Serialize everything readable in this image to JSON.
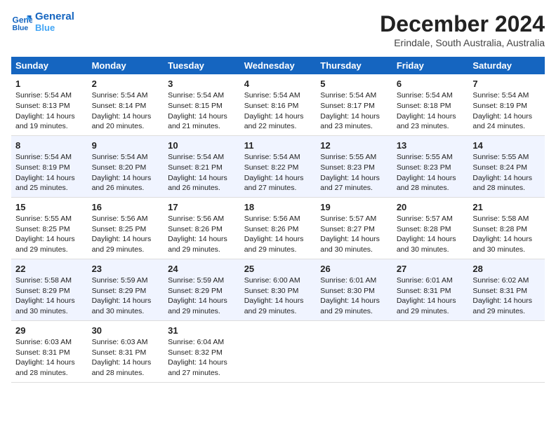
{
  "header": {
    "logo_line1": "General",
    "logo_line2": "Blue",
    "month": "December 2024",
    "location": "Erindale, South Australia, Australia"
  },
  "days_of_week": [
    "Sunday",
    "Monday",
    "Tuesday",
    "Wednesday",
    "Thursday",
    "Friday",
    "Saturday"
  ],
  "weeks": [
    [
      {
        "day": "1",
        "sunrise": "5:54 AM",
        "sunset": "8:13 PM",
        "daylight": "14 hours and 19 minutes."
      },
      {
        "day": "2",
        "sunrise": "5:54 AM",
        "sunset": "8:14 PM",
        "daylight": "14 hours and 20 minutes."
      },
      {
        "day": "3",
        "sunrise": "5:54 AM",
        "sunset": "8:15 PM",
        "daylight": "14 hours and 21 minutes."
      },
      {
        "day": "4",
        "sunrise": "5:54 AM",
        "sunset": "8:16 PM",
        "daylight": "14 hours and 22 minutes."
      },
      {
        "day": "5",
        "sunrise": "5:54 AM",
        "sunset": "8:17 PM",
        "daylight": "14 hours and 23 minutes."
      },
      {
        "day": "6",
        "sunrise": "5:54 AM",
        "sunset": "8:18 PM",
        "daylight": "14 hours and 23 minutes."
      },
      {
        "day": "7",
        "sunrise": "5:54 AM",
        "sunset": "8:19 PM",
        "daylight": "14 hours and 24 minutes."
      }
    ],
    [
      {
        "day": "8",
        "sunrise": "5:54 AM",
        "sunset": "8:19 PM",
        "daylight": "14 hours and 25 minutes."
      },
      {
        "day": "9",
        "sunrise": "5:54 AM",
        "sunset": "8:20 PM",
        "daylight": "14 hours and 26 minutes."
      },
      {
        "day": "10",
        "sunrise": "5:54 AM",
        "sunset": "8:21 PM",
        "daylight": "14 hours and 26 minutes."
      },
      {
        "day": "11",
        "sunrise": "5:54 AM",
        "sunset": "8:22 PM",
        "daylight": "14 hours and 27 minutes."
      },
      {
        "day": "12",
        "sunrise": "5:55 AM",
        "sunset": "8:23 PM",
        "daylight": "14 hours and 27 minutes."
      },
      {
        "day": "13",
        "sunrise": "5:55 AM",
        "sunset": "8:23 PM",
        "daylight": "14 hours and 28 minutes."
      },
      {
        "day": "14",
        "sunrise": "5:55 AM",
        "sunset": "8:24 PM",
        "daylight": "14 hours and 28 minutes."
      }
    ],
    [
      {
        "day": "15",
        "sunrise": "5:55 AM",
        "sunset": "8:25 PM",
        "daylight": "14 hours and 29 minutes."
      },
      {
        "day": "16",
        "sunrise": "5:56 AM",
        "sunset": "8:25 PM",
        "daylight": "14 hours and 29 minutes."
      },
      {
        "day": "17",
        "sunrise": "5:56 AM",
        "sunset": "8:26 PM",
        "daylight": "14 hours and 29 minutes."
      },
      {
        "day": "18",
        "sunrise": "5:56 AM",
        "sunset": "8:26 PM",
        "daylight": "14 hours and 29 minutes."
      },
      {
        "day": "19",
        "sunrise": "5:57 AM",
        "sunset": "8:27 PM",
        "daylight": "14 hours and 30 minutes."
      },
      {
        "day": "20",
        "sunrise": "5:57 AM",
        "sunset": "8:28 PM",
        "daylight": "14 hours and 30 minutes."
      },
      {
        "day": "21",
        "sunrise": "5:58 AM",
        "sunset": "8:28 PM",
        "daylight": "14 hours and 30 minutes."
      }
    ],
    [
      {
        "day": "22",
        "sunrise": "5:58 AM",
        "sunset": "8:29 PM",
        "daylight": "14 hours and 30 minutes."
      },
      {
        "day": "23",
        "sunrise": "5:59 AM",
        "sunset": "8:29 PM",
        "daylight": "14 hours and 30 minutes."
      },
      {
        "day": "24",
        "sunrise": "5:59 AM",
        "sunset": "8:29 PM",
        "daylight": "14 hours and 29 minutes."
      },
      {
        "day": "25",
        "sunrise": "6:00 AM",
        "sunset": "8:30 PM",
        "daylight": "14 hours and 29 minutes."
      },
      {
        "day": "26",
        "sunrise": "6:01 AM",
        "sunset": "8:30 PM",
        "daylight": "14 hours and 29 minutes."
      },
      {
        "day": "27",
        "sunrise": "6:01 AM",
        "sunset": "8:31 PM",
        "daylight": "14 hours and 29 minutes."
      },
      {
        "day": "28",
        "sunrise": "6:02 AM",
        "sunset": "8:31 PM",
        "daylight": "14 hours and 29 minutes."
      }
    ],
    [
      {
        "day": "29",
        "sunrise": "6:03 AM",
        "sunset": "8:31 PM",
        "daylight": "14 hours and 28 minutes."
      },
      {
        "day": "30",
        "sunrise": "6:03 AM",
        "sunset": "8:31 PM",
        "daylight": "14 hours and 28 minutes."
      },
      {
        "day": "31",
        "sunrise": "6:04 AM",
        "sunset": "8:32 PM",
        "daylight": "14 hours and 27 minutes."
      },
      null,
      null,
      null,
      null
    ]
  ],
  "labels": {
    "sunrise": "Sunrise:",
    "sunset": "Sunset:",
    "daylight": "Daylight:"
  }
}
